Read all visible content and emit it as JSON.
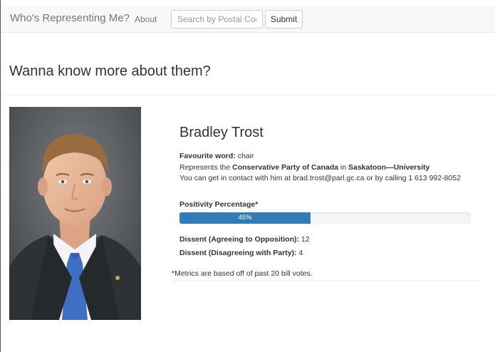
{
  "navbar": {
    "brand": "Who's Representing Me?",
    "about": "About",
    "search_placeholder": "Search by Postal Code",
    "search_value": "",
    "submit_label": "Submit"
  },
  "page": {
    "title": "Wanna know more about them?"
  },
  "photo": {
    "alt": "Bradley Trost"
  },
  "profile": {
    "name": "Bradley Trost",
    "favourite_label": "Favourite word:",
    "favourite_value": "chair",
    "represents_prefix": "Represents the",
    "party": "Conservative Party of Canada",
    "in_word": "in",
    "riding": "Saskatoon—University",
    "contact_text": "You can get in contact with him at brad.trost@parl.gc.ca or by calling 1 613 992-8052",
    "positivity_label": "Positivity Percentage*",
    "positivity_value": 0.45,
    "positivity_text": "45%",
    "dissent_opposition_label": "Dissent (Agreeing to Opposition):",
    "dissent_opposition_value": "12",
    "dissent_party_label": "Dissent (Disagreeing with Party):",
    "dissent_party_value": "4",
    "footnote": "*Metrics are based off of past 20 bill votes."
  },
  "colors": {
    "progress_fill": "#337ab7",
    "navbar_bg": "#f8f8f8"
  }
}
